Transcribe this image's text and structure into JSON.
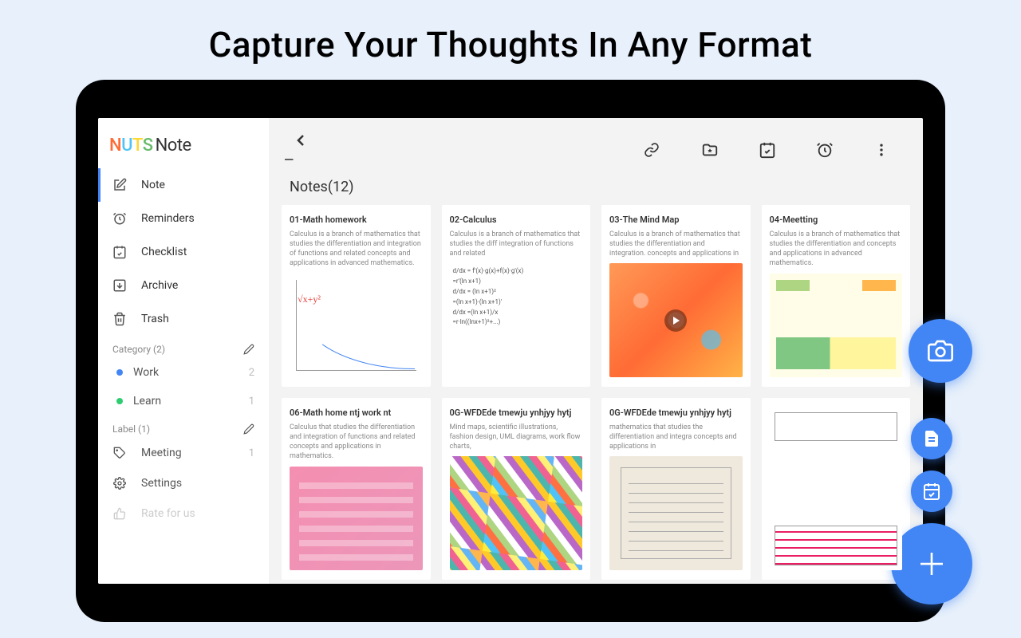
{
  "headline": "Capture Your Thoughts In Any Format",
  "logo": {
    "n": "N",
    "u": "U",
    "t": "T",
    "s": "S",
    "note": "Note"
  },
  "sidebar": {
    "nav": [
      {
        "label": "Note",
        "icon": "note-icon"
      },
      {
        "label": "Reminders",
        "icon": "clock-icon"
      },
      {
        "label": "Checklist",
        "icon": "checklist-icon"
      },
      {
        "label": "Archive",
        "icon": "archive-icon"
      },
      {
        "label": "Trash",
        "icon": "trash-icon"
      }
    ],
    "category_header": "Category (2)",
    "categories": [
      {
        "label": "Work",
        "count": "2",
        "color": "#4285f4"
      },
      {
        "label": "Learn",
        "count": "1",
        "color": "#2ecc71"
      }
    ],
    "label_header": "Label (1)",
    "labels": [
      {
        "label": "Meeting",
        "count": "1"
      }
    ],
    "settings_label": "Settings",
    "rate_label": "Rate for us"
  },
  "main": {
    "title": "Notes(12)",
    "notes": [
      {
        "title": "01-Math homework",
        "body": "Calculus is a branch of mathematics that studies the differentiation and integration of functions and related concepts and applications in advanced mathematics."
      },
      {
        "title": "02-Calculus",
        "body": "Calculus is a branch of mathematics that studies the diff integration of functions and related"
      },
      {
        "title": "03-The Mind Map",
        "body": "Calculus is a branch of mathematics that studies the differentiation and integration.\nconcepts and applications in"
      },
      {
        "title": "04-Meetting",
        "body": "Calculus is a branch of mathematics that studies the differentiation and\n\nconcepts and applications in advanced mathematics."
      },
      {
        "title": "06-Math home ntj work nt",
        "body": "Calculus\nthat studies the differentiation and integration of functions and related concepts and applications in mathematics."
      },
      {
        "title": "0G-WFDEde tmewju ynhjyy hytj",
        "body": "Mind maps, scientific illustrations, fashion design, UML diagrams, work flow charts,"
      },
      {
        "title": "0G-WFDEde tmewju ynhjyy hytj",
        "body": "mathematics\nthat studies the differentiation and integra\nconcepts and applications in"
      },
      {
        "title": "",
        "body": ""
      }
    ]
  }
}
